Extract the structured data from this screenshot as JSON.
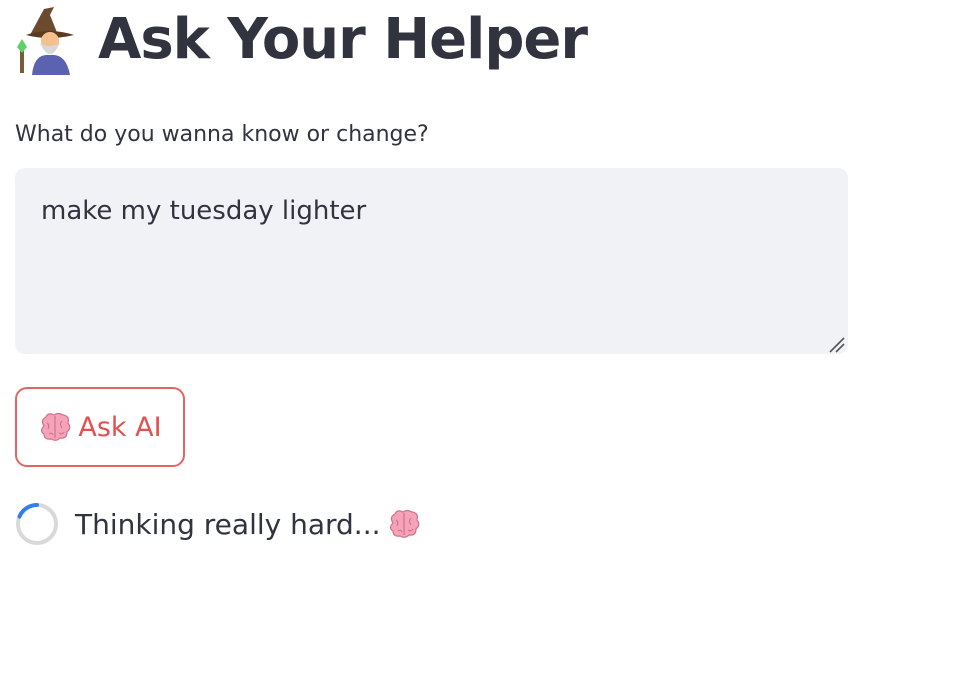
{
  "header": {
    "title": "Ask Your Helper",
    "icon": "wizard-icon"
  },
  "prompt": {
    "label": "What do you wanna know or change?",
    "value": "make my tuesday lighter"
  },
  "ask_button": {
    "label": "Ask AI",
    "icon": "brain-icon"
  },
  "status": {
    "text": "Thinking really hard...",
    "icon": "brain-icon",
    "spinner": "loading-spinner-icon"
  },
  "colors": {
    "accent": "#e2514f",
    "text": "#31333f",
    "input_bg": "#f0f2f6",
    "spinner_active": "#2f80ed",
    "spinner_track": "#d9d9d9"
  }
}
